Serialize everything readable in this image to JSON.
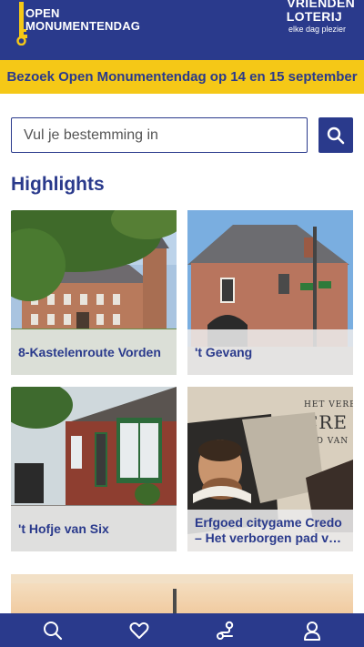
{
  "header": {
    "logo_line1": "OPEN",
    "logo_line2": "MONUMENTENDAG",
    "partner_line1": "VRIENDEN",
    "partner_line2": "LOTERIJ",
    "partner_tagline": "elke dag plezier"
  },
  "banner": {
    "text": "Bezoek Open Monumentendag op 14 en 15 september"
  },
  "search": {
    "placeholder": "Vul je bestemming in"
  },
  "highlights": {
    "title": "Highlights",
    "items": [
      {
        "label": "8-Kastelenroute Vorden"
      },
      {
        "label": "'t Gevang"
      },
      {
        "label": "'t Hofje van Six"
      },
      {
        "label": "Erfgoed citygame Credo – Het verborgen pad van Willem"
      }
    ],
    "card4_overlay": {
      "line1": "HET VERBO",
      "line2": "CRE",
      "line3": "PAD VAN"
    }
  },
  "colors": {
    "brand_blue": "#2a3a8c",
    "banner_yellow": "#f5c817"
  },
  "nav": {
    "items": [
      {
        "icon": "search-icon"
      },
      {
        "icon": "heart-icon"
      },
      {
        "icon": "route-icon"
      },
      {
        "icon": "user-icon"
      }
    ]
  }
}
